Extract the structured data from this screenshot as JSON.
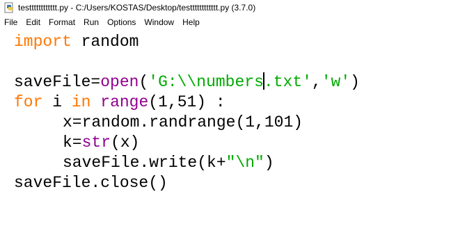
{
  "window": {
    "title": "testttttttttttt.py - C:/Users/KOSTAS/Desktop/testttttttttttt.py (3.7.0)"
  },
  "menu": [
    "File",
    "Edit",
    "Format",
    "Run",
    "Options",
    "Window",
    "Help"
  ],
  "colors": {
    "keyword": "#ff7700",
    "builtin": "#900090",
    "string": "#00aa00",
    "default": "#000000"
  },
  "code": {
    "l1_kw": "import",
    "l1_rest": " random",
    "l3_a": "saveFile=",
    "l3_bi": "open",
    "l3_b": "(",
    "l3_s1": "'G:\\\\numbers",
    "l3_s2": ".txt'",
    "l3_c": ",",
    "l3_s3": "'w'",
    "l3_d": ")",
    "l4_kw1": "for",
    "l4_a": " i ",
    "l4_kw2": "in",
    "l4_b": " ",
    "l4_bi": "range",
    "l4_c": "(1,51) :",
    "l5": "x=random.randrange(1,101)",
    "l6_a": "k=",
    "l6_bi": "str",
    "l6_b": "(x)",
    "l7_a": "saveFile.write(k+",
    "l7_s": "\"\\n\"",
    "l7_b": ")",
    "l8": "saveFile.close()"
  }
}
